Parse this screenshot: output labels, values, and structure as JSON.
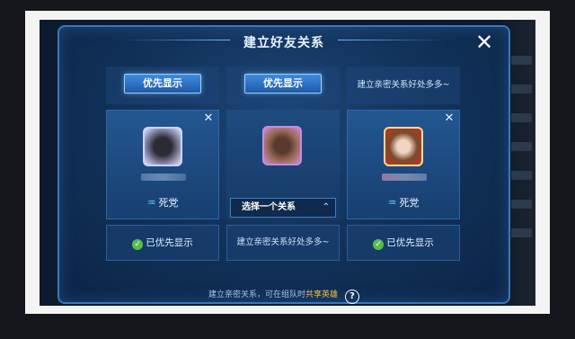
{
  "dialog": {
    "title": "建立好友关系",
    "close_icon": "close-icon",
    "footer_text": "建立亲密关系，可在组队时",
    "footer_highlight": "共享英雄",
    "help_symbol": "?"
  },
  "slots": [
    {
      "top_button": "优先显示",
      "role": "死党",
      "role_icon": "rune-icon",
      "bottom_label": "已优先显示"
    },
    {
      "top_button": "优先显示",
      "select_label": "选择一个关系",
      "bottom_label": "建立亲密关系好处多多~"
    },
    {
      "top_text": "建立亲密关系好处多多~",
      "role": "死党",
      "role_icon": "rune-icon",
      "bottom_label": "已优先显示"
    }
  ],
  "colors": {
    "accent": "#3e8be0",
    "check": "#56c04a",
    "highlight": "#f1c24a"
  }
}
